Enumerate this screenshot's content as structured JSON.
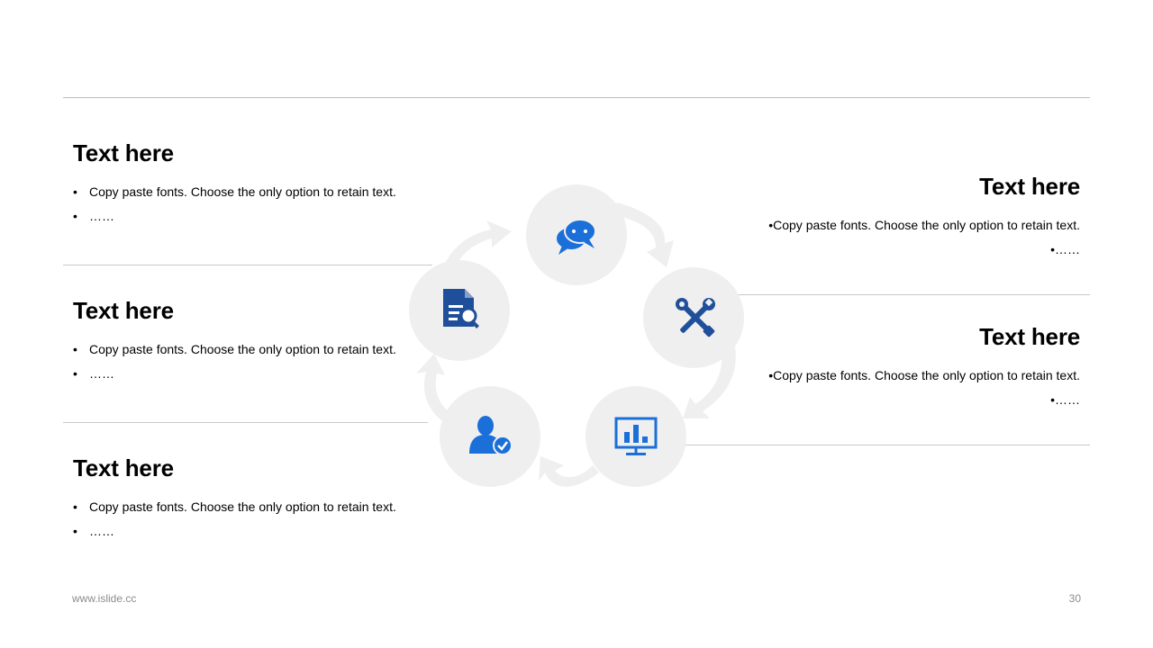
{
  "sections": {
    "left": [
      {
        "title": "Text here",
        "bullets": [
          "Copy paste fonts. Choose the only option to retain text.",
          "……"
        ]
      },
      {
        "title": "Text here",
        "bullets": [
          "Copy paste fonts. Choose the only option to retain text.",
          "……"
        ]
      },
      {
        "title": "Text here",
        "bullets": [
          "Copy paste fonts. Choose the only option to retain text.",
          "……"
        ]
      }
    ],
    "right": [
      {
        "title": "Text here",
        "bullets": [
          "Copy paste fonts. Choose the only option to retain text.",
          "……"
        ]
      },
      {
        "title": "Text here",
        "bullets": [
          "Copy paste fonts. Choose the only option to retain text.",
          "……"
        ]
      }
    ]
  },
  "bullet_symbol": "•",
  "cycle": {
    "nodes": [
      {
        "icon": "chat-bubbles-icon",
        "color": "#1a6fd9"
      },
      {
        "icon": "tools-icon",
        "color": "#1f4f9a"
      },
      {
        "icon": "presentation-chart-icon",
        "color": "#1a6fd9"
      },
      {
        "icon": "user-verified-icon",
        "color": "#1a6fd9"
      },
      {
        "icon": "document-search-icon",
        "color": "#1f4f9a"
      }
    ],
    "circle_color": "#efefef"
  },
  "footer": {
    "url": "www.islide.cc",
    "page": "30"
  }
}
